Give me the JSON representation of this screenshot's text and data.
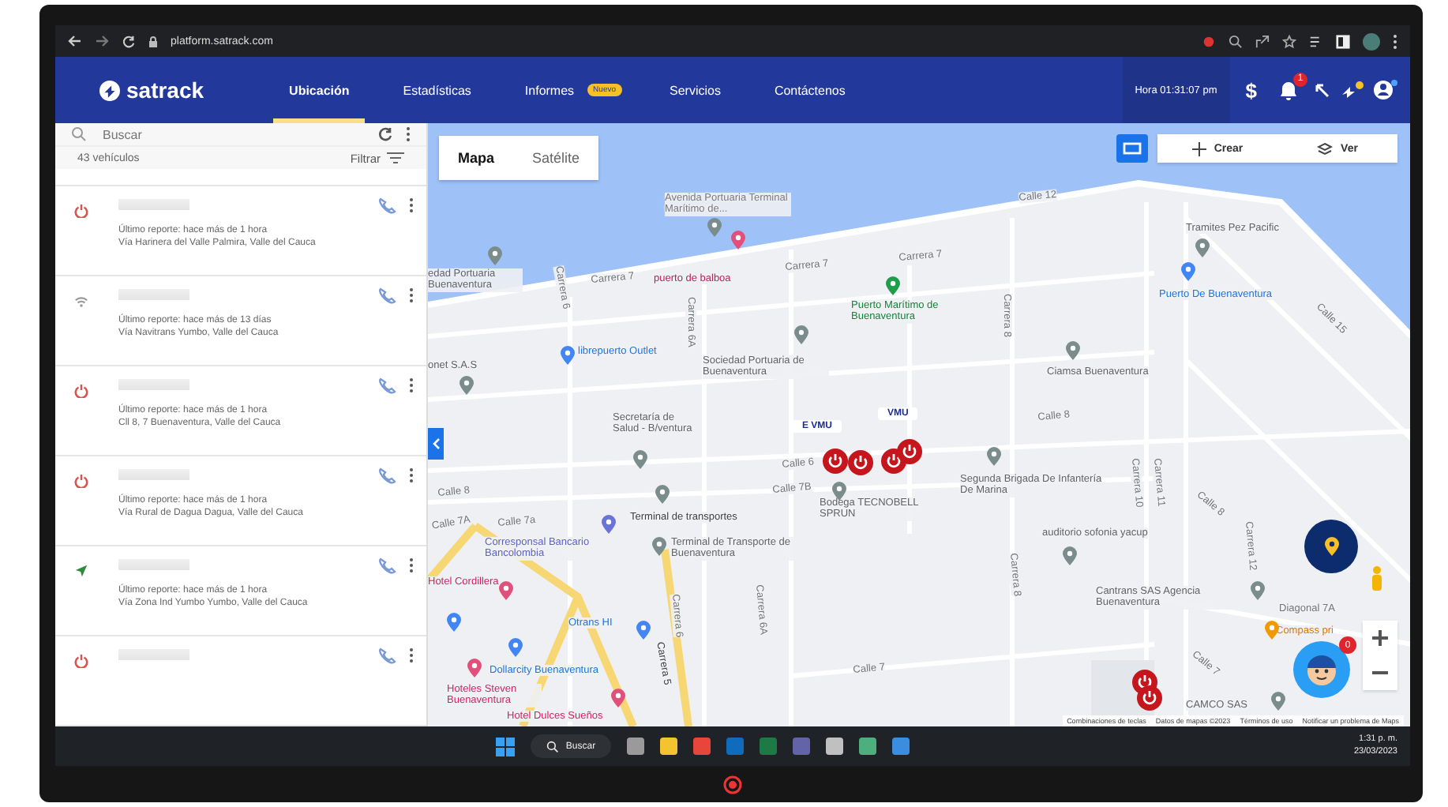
{
  "browser": {
    "url": "platform.satrack.com"
  },
  "nav": {
    "logo": "satrack",
    "items": [
      {
        "label": "Ubicación",
        "selected": true
      },
      {
        "label": "Estadísticas",
        "selected": false
      },
      {
        "label": "Informes",
        "selected": false,
        "badge": "Nuevo"
      },
      {
        "label": "Servicios",
        "selected": false
      },
      {
        "label": "Contáctenos",
        "selected": false
      }
    ],
    "clock": "Hora 01:31:07 pm",
    "currency": "$",
    "notifications": "1"
  },
  "sidebar": {
    "search": {
      "placeholder": "Buscar"
    },
    "count": "43 vehículos",
    "filter": "Filtrar",
    "vehicles": [
      {
        "kind": "off",
        "report": "Último reporte: hace más de 1 hora",
        "address": "Vía Harinera del Valle Palmira, Valle del Cauca"
      },
      {
        "kind": "signal",
        "report": "Último reporte: hace más de 13 días",
        "address": "Vía Navitrans Yumbo, Valle del Cauca"
      },
      {
        "kind": "off",
        "report": "Último reporte: hace más de 1 hora",
        "address": "Cll 8, 7 Buenaventura, Valle del Cauca"
      },
      {
        "kind": "off",
        "report": "Último reporte: hace más de 1 hora",
        "address": "Vía Rural de Dagua Dagua, Valle del Cauca"
      },
      {
        "kind": "moving",
        "report": "Último reporte: hace más de 1 hora",
        "address": "Vía Zona Ind Yumbo Yumbo, Valle del Cauca"
      },
      {
        "kind": "off"
      }
    ]
  },
  "map": {
    "tabs": [
      {
        "label": "Mapa",
        "selected": true
      },
      {
        "label": "Satélite",
        "selected": false
      }
    ],
    "actions": [
      "Crear",
      "Ver"
    ],
    "labels": [
      {
        "text": "Avenida Portuaria Terminal Marítimo de...",
        "color": "#7a7a7a"
      },
      {
        "text": "edad Portuaria Buenaventura",
        "color": "#5f6368"
      },
      {
        "text": "puerto de balboa",
        "color": "#c2185b"
      },
      {
        "text": "Carrera 7",
        "color": "#70757a"
      },
      {
        "text": "Carrera 7",
        "color": "#70757a"
      },
      {
        "text": "Carrera 7",
        "color": "#70757a"
      },
      {
        "text": "Calle 12",
        "color": "#70757a"
      },
      {
        "text": "Carrera 6",
        "color": "#70757a"
      },
      {
        "text": "Carrera 6A",
        "color": "#70757a"
      },
      {
        "text": "Puerto Marítimo de Buenaventura",
        "color": "#188038"
      },
      {
        "text": "Tramites Pez Pacific",
        "color": "#5f6368"
      },
      {
        "text": "Puerto De Buenaventura",
        "color": "#1a73e8"
      },
      {
        "text": "Calle 15",
        "color": "#70757a"
      },
      {
        "text": "librepuerto Outlet",
        "color": "#1a73e8"
      },
      {
        "text": "onet S.A.S",
        "color": "#5f6368"
      },
      {
        "text": "Sociedad Portuaria de Buenaventura",
        "color": "#5f6368"
      },
      {
        "text": "Carrera 8",
        "color": "#70757a"
      },
      {
        "text": "Ciamsa Buenaventura",
        "color": "#5f6368"
      },
      {
        "text": "Secretaría de Salud - B/ventura",
        "color": "#5f6368"
      },
      {
        "text": "Calle 8",
        "color": "#70757a"
      },
      {
        "text": "Calle 6",
        "color": "#70757a"
      },
      {
        "text": "Calle 7B",
        "color": "#70757a"
      },
      {
        "text": "Bodega TECNOBELL SPRUN",
        "color": "#5f6368"
      },
      {
        "text": "Segunda Brigada De Infantería De Marina",
        "color": "#5f6368"
      },
      {
        "text": "Calle 8",
        "color": "#70757a"
      },
      {
        "text": "Calle 7A",
        "color": "#70757a"
      },
      {
        "text": "Calle 7a",
        "color": "#70757a"
      },
      {
        "text": "Terminal de transportes",
        "color": "#3c4043"
      },
      {
        "text": "Corresponsal Bancario Bancolombia",
        "color": "#5b5fc7"
      },
      {
        "text": "Terminal de Transporte de Buenaventura",
        "color": "#5f6368"
      },
      {
        "text": "Carrera 10",
        "color": "#70757a"
      },
      {
        "text": "Carrera 11",
        "color": "#70757a"
      },
      {
        "text": "Carrera 8",
        "color": "#70757a"
      },
      {
        "text": "auditorio sofonia yacup",
        "color": "#5f6368"
      },
      {
        "text": "Carrera 12",
        "color": "#70757a"
      },
      {
        "text": "Calle 8",
        "color": "#70757a"
      },
      {
        "text": "Hotel Cordillera",
        "color": "#d81b60"
      },
      {
        "text": "Otrans HI",
        "color": "#1a73e8"
      },
      {
        "text": "Carrera 6",
        "color": "#70757a"
      },
      {
        "text": "Carrera 6A",
        "color": "#70757a"
      },
      {
        "text": "Cantrans SAS Agencia Buenaventura",
        "color": "#5f6368"
      },
      {
        "text": "Diagonal 7A",
        "color": "#70757a"
      },
      {
        "text": "Compass pri",
        "color": "#e37400"
      },
      {
        "text": "Dollarcity Buenaventura",
        "color": "#1a73e8"
      },
      {
        "text": "Carrera 5",
        "color": "#3c4043"
      },
      {
        "text": "Calle 7",
        "color": "#70757a"
      },
      {
        "text": "Calle 7",
        "color": "#70757a"
      },
      {
        "text": "Hoteles Steven Buenaventura",
        "color": "#d81b60"
      },
      {
        "text": "Hotel Dulces Sueños",
        "color": "#d81b60"
      },
      {
        "text": "CAMCO SAS",
        "color": "#5f6368"
      }
    ],
    "vehicle_tags": [
      "E VMU",
      "VMU"
    ],
    "chat_badge": "0",
    "attribution": [
      "Combinaciones de teclas",
      "Datos de mapas ©2023",
      "Términos de uso",
      "Notificar un problema de Maps"
    ]
  },
  "taskbar": {
    "search": "Buscar",
    "time": "1:31 p. m.",
    "date": "23/03/2023"
  }
}
